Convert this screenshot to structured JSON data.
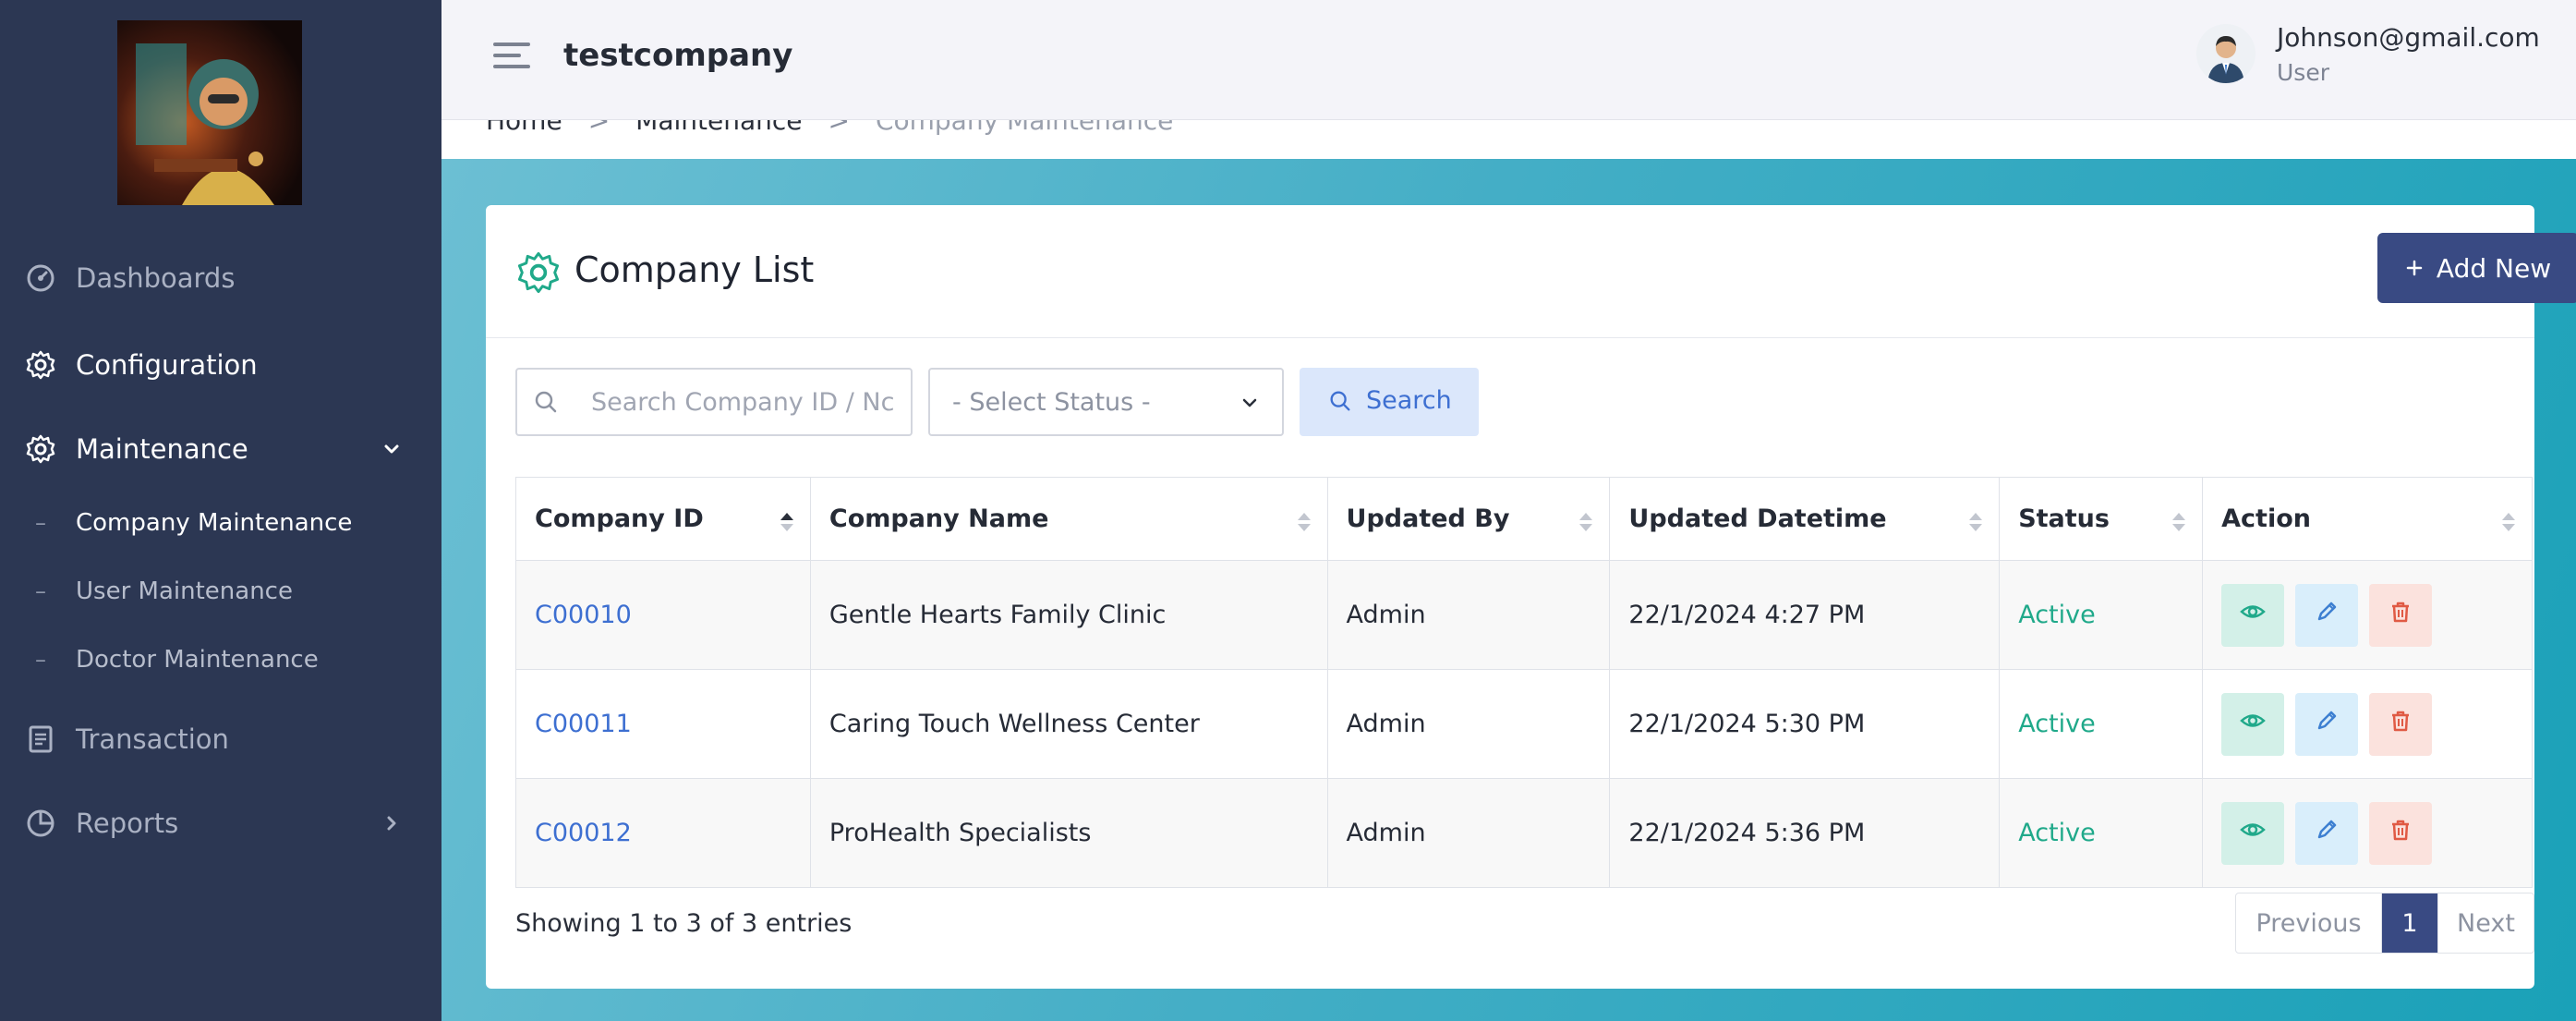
{
  "app": {
    "company": "testcompany"
  },
  "user": {
    "email": "Johnson@gmail.com",
    "role": "User"
  },
  "sidebar": {
    "items": [
      {
        "label": "Dashboards",
        "icon": "gauge-icon"
      },
      {
        "label": "Configuration",
        "icon": "gear-icon"
      },
      {
        "label": "Maintenance",
        "icon": "gear-icon",
        "expanded": true
      },
      {
        "label": "Transaction",
        "icon": "document-icon"
      },
      {
        "label": "Reports",
        "icon": "pie-chart-icon"
      }
    ],
    "sub_items": [
      {
        "label": "Company Maintenance",
        "active": true
      },
      {
        "label": "User Maintenance"
      },
      {
        "label": "Doctor Maintenance"
      }
    ]
  },
  "breadcrumb": {
    "home": "Home",
    "section": "Maintenance",
    "current": "Company Maintenance"
  },
  "card": {
    "title": "Company List",
    "add_label": "Add New"
  },
  "filters": {
    "search_placeholder": "Search Company ID / Nc",
    "status_placeholder": "- Select Status -",
    "search_label": "Search"
  },
  "table": {
    "headers": [
      "Company ID",
      "Company Name",
      "Updated By",
      "Updated Datetime",
      "Status",
      "Action"
    ],
    "rows": [
      {
        "id": "C00010",
        "name": "Gentle Hearts Family Clinic",
        "updated_by": "Admin",
        "updated_at": "22/1/2024 4:27 PM",
        "status": "Active"
      },
      {
        "id": "C00011",
        "name": "Caring Touch Wellness Center",
        "updated_by": "Admin",
        "updated_at": "22/1/2024 5:30 PM",
        "status": "Active"
      },
      {
        "id": "C00012",
        "name": "ProHealth Specialists",
        "updated_by": "Admin",
        "updated_at": "22/1/2024 5:36 PM",
        "status": "Active"
      }
    ]
  },
  "footer": {
    "showing": "Showing 1 to 3 of 3 entries",
    "prev": "Previous",
    "page": "1",
    "next": "Next"
  },
  "colors": {
    "sidebar": "#2c3753",
    "accent": "#394a83",
    "link": "#3d6fd1",
    "active": "#20a98a"
  }
}
